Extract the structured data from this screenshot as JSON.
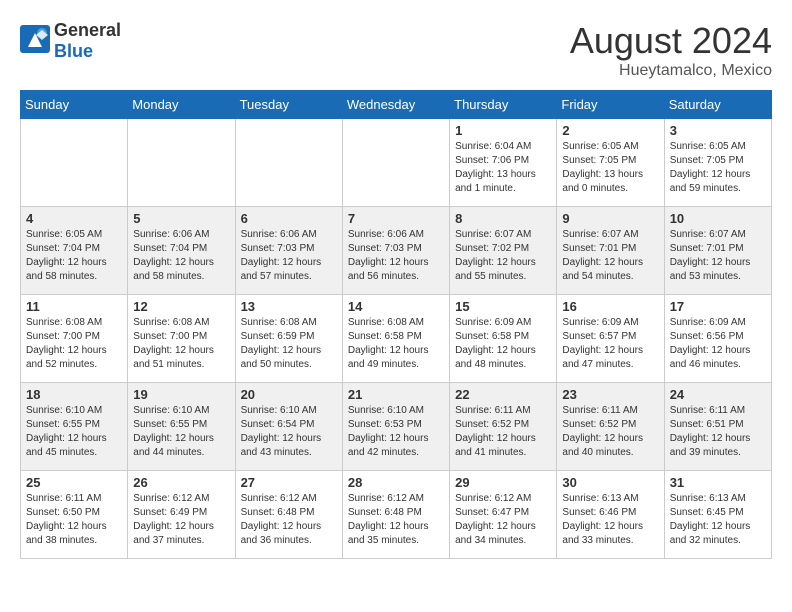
{
  "header": {
    "logo_general": "General",
    "logo_blue": "Blue",
    "month_year": "August 2024",
    "location": "Hueytamalco, Mexico"
  },
  "days_of_week": [
    "Sunday",
    "Monday",
    "Tuesday",
    "Wednesday",
    "Thursday",
    "Friday",
    "Saturday"
  ],
  "weeks": [
    [
      {
        "day": "",
        "info": ""
      },
      {
        "day": "",
        "info": ""
      },
      {
        "day": "",
        "info": ""
      },
      {
        "day": "",
        "info": ""
      },
      {
        "day": "1",
        "info": "Sunrise: 6:04 AM\nSunset: 7:06 PM\nDaylight: 13 hours\nand 1 minute."
      },
      {
        "day": "2",
        "info": "Sunrise: 6:05 AM\nSunset: 7:05 PM\nDaylight: 13 hours\nand 0 minutes."
      },
      {
        "day": "3",
        "info": "Sunrise: 6:05 AM\nSunset: 7:05 PM\nDaylight: 12 hours\nand 59 minutes."
      }
    ],
    [
      {
        "day": "4",
        "info": "Sunrise: 6:05 AM\nSunset: 7:04 PM\nDaylight: 12 hours\nand 58 minutes."
      },
      {
        "day": "5",
        "info": "Sunrise: 6:06 AM\nSunset: 7:04 PM\nDaylight: 12 hours\nand 58 minutes."
      },
      {
        "day": "6",
        "info": "Sunrise: 6:06 AM\nSunset: 7:03 PM\nDaylight: 12 hours\nand 57 minutes."
      },
      {
        "day": "7",
        "info": "Sunrise: 6:06 AM\nSunset: 7:03 PM\nDaylight: 12 hours\nand 56 minutes."
      },
      {
        "day": "8",
        "info": "Sunrise: 6:07 AM\nSunset: 7:02 PM\nDaylight: 12 hours\nand 55 minutes."
      },
      {
        "day": "9",
        "info": "Sunrise: 6:07 AM\nSunset: 7:01 PM\nDaylight: 12 hours\nand 54 minutes."
      },
      {
        "day": "10",
        "info": "Sunrise: 6:07 AM\nSunset: 7:01 PM\nDaylight: 12 hours\nand 53 minutes."
      }
    ],
    [
      {
        "day": "11",
        "info": "Sunrise: 6:08 AM\nSunset: 7:00 PM\nDaylight: 12 hours\nand 52 minutes."
      },
      {
        "day": "12",
        "info": "Sunrise: 6:08 AM\nSunset: 7:00 PM\nDaylight: 12 hours\nand 51 minutes."
      },
      {
        "day": "13",
        "info": "Sunrise: 6:08 AM\nSunset: 6:59 PM\nDaylight: 12 hours\nand 50 minutes."
      },
      {
        "day": "14",
        "info": "Sunrise: 6:08 AM\nSunset: 6:58 PM\nDaylight: 12 hours\nand 49 minutes."
      },
      {
        "day": "15",
        "info": "Sunrise: 6:09 AM\nSunset: 6:58 PM\nDaylight: 12 hours\nand 48 minutes."
      },
      {
        "day": "16",
        "info": "Sunrise: 6:09 AM\nSunset: 6:57 PM\nDaylight: 12 hours\nand 47 minutes."
      },
      {
        "day": "17",
        "info": "Sunrise: 6:09 AM\nSunset: 6:56 PM\nDaylight: 12 hours\nand 46 minutes."
      }
    ],
    [
      {
        "day": "18",
        "info": "Sunrise: 6:10 AM\nSunset: 6:55 PM\nDaylight: 12 hours\nand 45 minutes."
      },
      {
        "day": "19",
        "info": "Sunrise: 6:10 AM\nSunset: 6:55 PM\nDaylight: 12 hours\nand 44 minutes."
      },
      {
        "day": "20",
        "info": "Sunrise: 6:10 AM\nSunset: 6:54 PM\nDaylight: 12 hours\nand 43 minutes."
      },
      {
        "day": "21",
        "info": "Sunrise: 6:10 AM\nSunset: 6:53 PM\nDaylight: 12 hours\nand 42 minutes."
      },
      {
        "day": "22",
        "info": "Sunrise: 6:11 AM\nSunset: 6:52 PM\nDaylight: 12 hours\nand 41 minutes."
      },
      {
        "day": "23",
        "info": "Sunrise: 6:11 AM\nSunset: 6:52 PM\nDaylight: 12 hours\nand 40 minutes."
      },
      {
        "day": "24",
        "info": "Sunrise: 6:11 AM\nSunset: 6:51 PM\nDaylight: 12 hours\nand 39 minutes."
      }
    ],
    [
      {
        "day": "25",
        "info": "Sunrise: 6:11 AM\nSunset: 6:50 PM\nDaylight: 12 hours\nand 38 minutes."
      },
      {
        "day": "26",
        "info": "Sunrise: 6:12 AM\nSunset: 6:49 PM\nDaylight: 12 hours\nand 37 minutes."
      },
      {
        "day": "27",
        "info": "Sunrise: 6:12 AM\nSunset: 6:48 PM\nDaylight: 12 hours\nand 36 minutes."
      },
      {
        "day": "28",
        "info": "Sunrise: 6:12 AM\nSunset: 6:48 PM\nDaylight: 12 hours\nand 35 minutes."
      },
      {
        "day": "29",
        "info": "Sunrise: 6:12 AM\nSunset: 6:47 PM\nDaylight: 12 hours\nand 34 minutes."
      },
      {
        "day": "30",
        "info": "Sunrise: 6:13 AM\nSunset: 6:46 PM\nDaylight: 12 hours\nand 33 minutes."
      },
      {
        "day": "31",
        "info": "Sunrise: 6:13 AM\nSunset: 6:45 PM\nDaylight: 12 hours\nand 32 minutes."
      }
    ]
  ]
}
